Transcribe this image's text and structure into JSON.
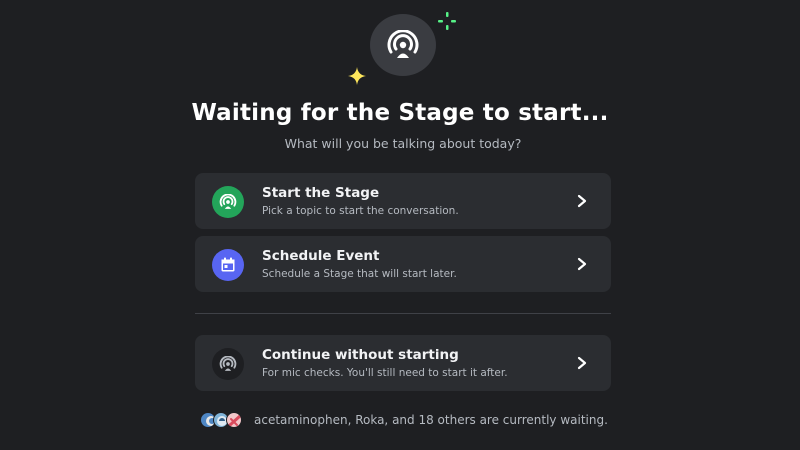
{
  "header": {
    "title": "Waiting for the Stage to start...",
    "subtitle": "What will you be talking about today?"
  },
  "options": [
    {
      "id": "start",
      "title": "Start the Stage",
      "description": "Pick a topic to start the conversation.",
      "icon": "stage-icon",
      "icon_color": "#23a55a"
    },
    {
      "id": "schedule",
      "title": "Schedule Event",
      "description": "Schedule a Stage that will start later.",
      "icon": "calendar-icon",
      "icon_color": "#5865f2"
    },
    {
      "id": "continue",
      "title": "Continue without starting",
      "description": "For mic checks.  You'll still need to start it after.",
      "icon": "stage-icon",
      "icon_color": "#1e1f22"
    }
  ],
  "waiting": {
    "text": "acetaminophen, Roka, and 18 others are currently waiting."
  },
  "colors": {
    "background": "#1e1f22",
    "card": "#2b2d31",
    "sparkle_green": "#57f287",
    "sparkle_yellow": "#fee75c"
  }
}
